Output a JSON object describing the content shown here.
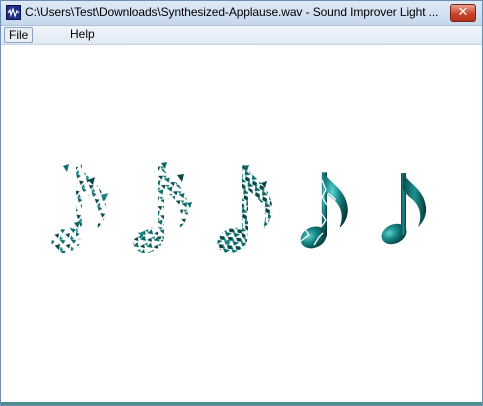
{
  "window": {
    "title": "C:\\Users\\Test\\Downloads\\Synthesized-Applause.wav - Sound Improver Light ...",
    "close_label": "✕",
    "app_icon": "waveform-icon"
  },
  "menu": {
    "file_label": "File",
    "help_label": "Help"
  },
  "animation": {
    "icon": "music-note-icon",
    "frames": 5,
    "note_color": "#0f7676",
    "note_shadow": "#0a3c3c"
  }
}
